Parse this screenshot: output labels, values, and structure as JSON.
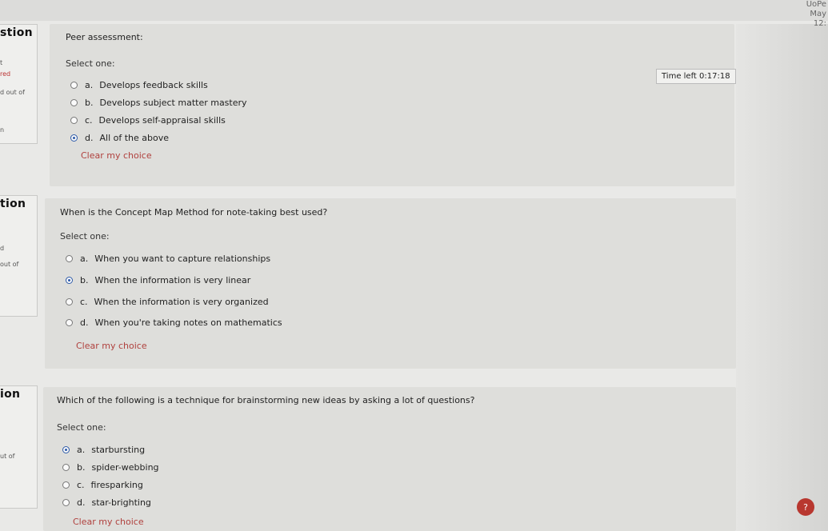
{
  "topright": {
    "line1": "UoPe",
    "line2": "May",
    "line3": "12:"
  },
  "timer": {
    "label": "Time left 0:17:18"
  },
  "help": {
    "label": "?"
  },
  "questions": [
    {
      "num_label": "stion",
      "info": [
        "t",
        "red",
        "d out of",
        "n"
      ],
      "text": "Peer assessment:",
      "select_label": "Select one:",
      "options": [
        {
          "letter": "a.",
          "text": "Develops feedback skills",
          "selected": false
        },
        {
          "letter": "b.",
          "text": "Develops subject matter mastery",
          "selected": false
        },
        {
          "letter": "c.",
          "text": "Develops self-appraisal skills",
          "selected": false
        },
        {
          "letter": "d.",
          "text": "All of the above",
          "selected": true
        }
      ],
      "clear_label": "Clear my choice"
    },
    {
      "num_label": "tion",
      "info": [
        "d",
        "out of"
      ],
      "text": "When is the Concept Map Method for note-taking best used?",
      "select_label": "Select one:",
      "options": [
        {
          "letter": "a.",
          "text": "When you want to capture relationships",
          "selected": false
        },
        {
          "letter": "b.",
          "text": "When the information is very linear",
          "selected": true
        },
        {
          "letter": "c.",
          "text": "When the information is very organized",
          "selected": false
        },
        {
          "letter": "d.",
          "text": "When you're taking notes on mathematics",
          "selected": false
        }
      ],
      "clear_label": "Clear my choice"
    },
    {
      "num_label": "ion",
      "info": [
        "ut of"
      ],
      "text": "Which of the following is a technique for brainstorming new ideas by asking a lot of questions?",
      "select_label": "Select one:",
      "options": [
        {
          "letter": "a.",
          "text": "starbursting",
          "selected": true
        },
        {
          "letter": "b.",
          "text": "spider-webbing",
          "selected": false
        },
        {
          "letter": "c.",
          "text": "firesparking",
          "selected": false
        },
        {
          "letter": "d.",
          "text": "star-brighting",
          "selected": false
        }
      ],
      "clear_label": "Clear my choice"
    }
  ]
}
